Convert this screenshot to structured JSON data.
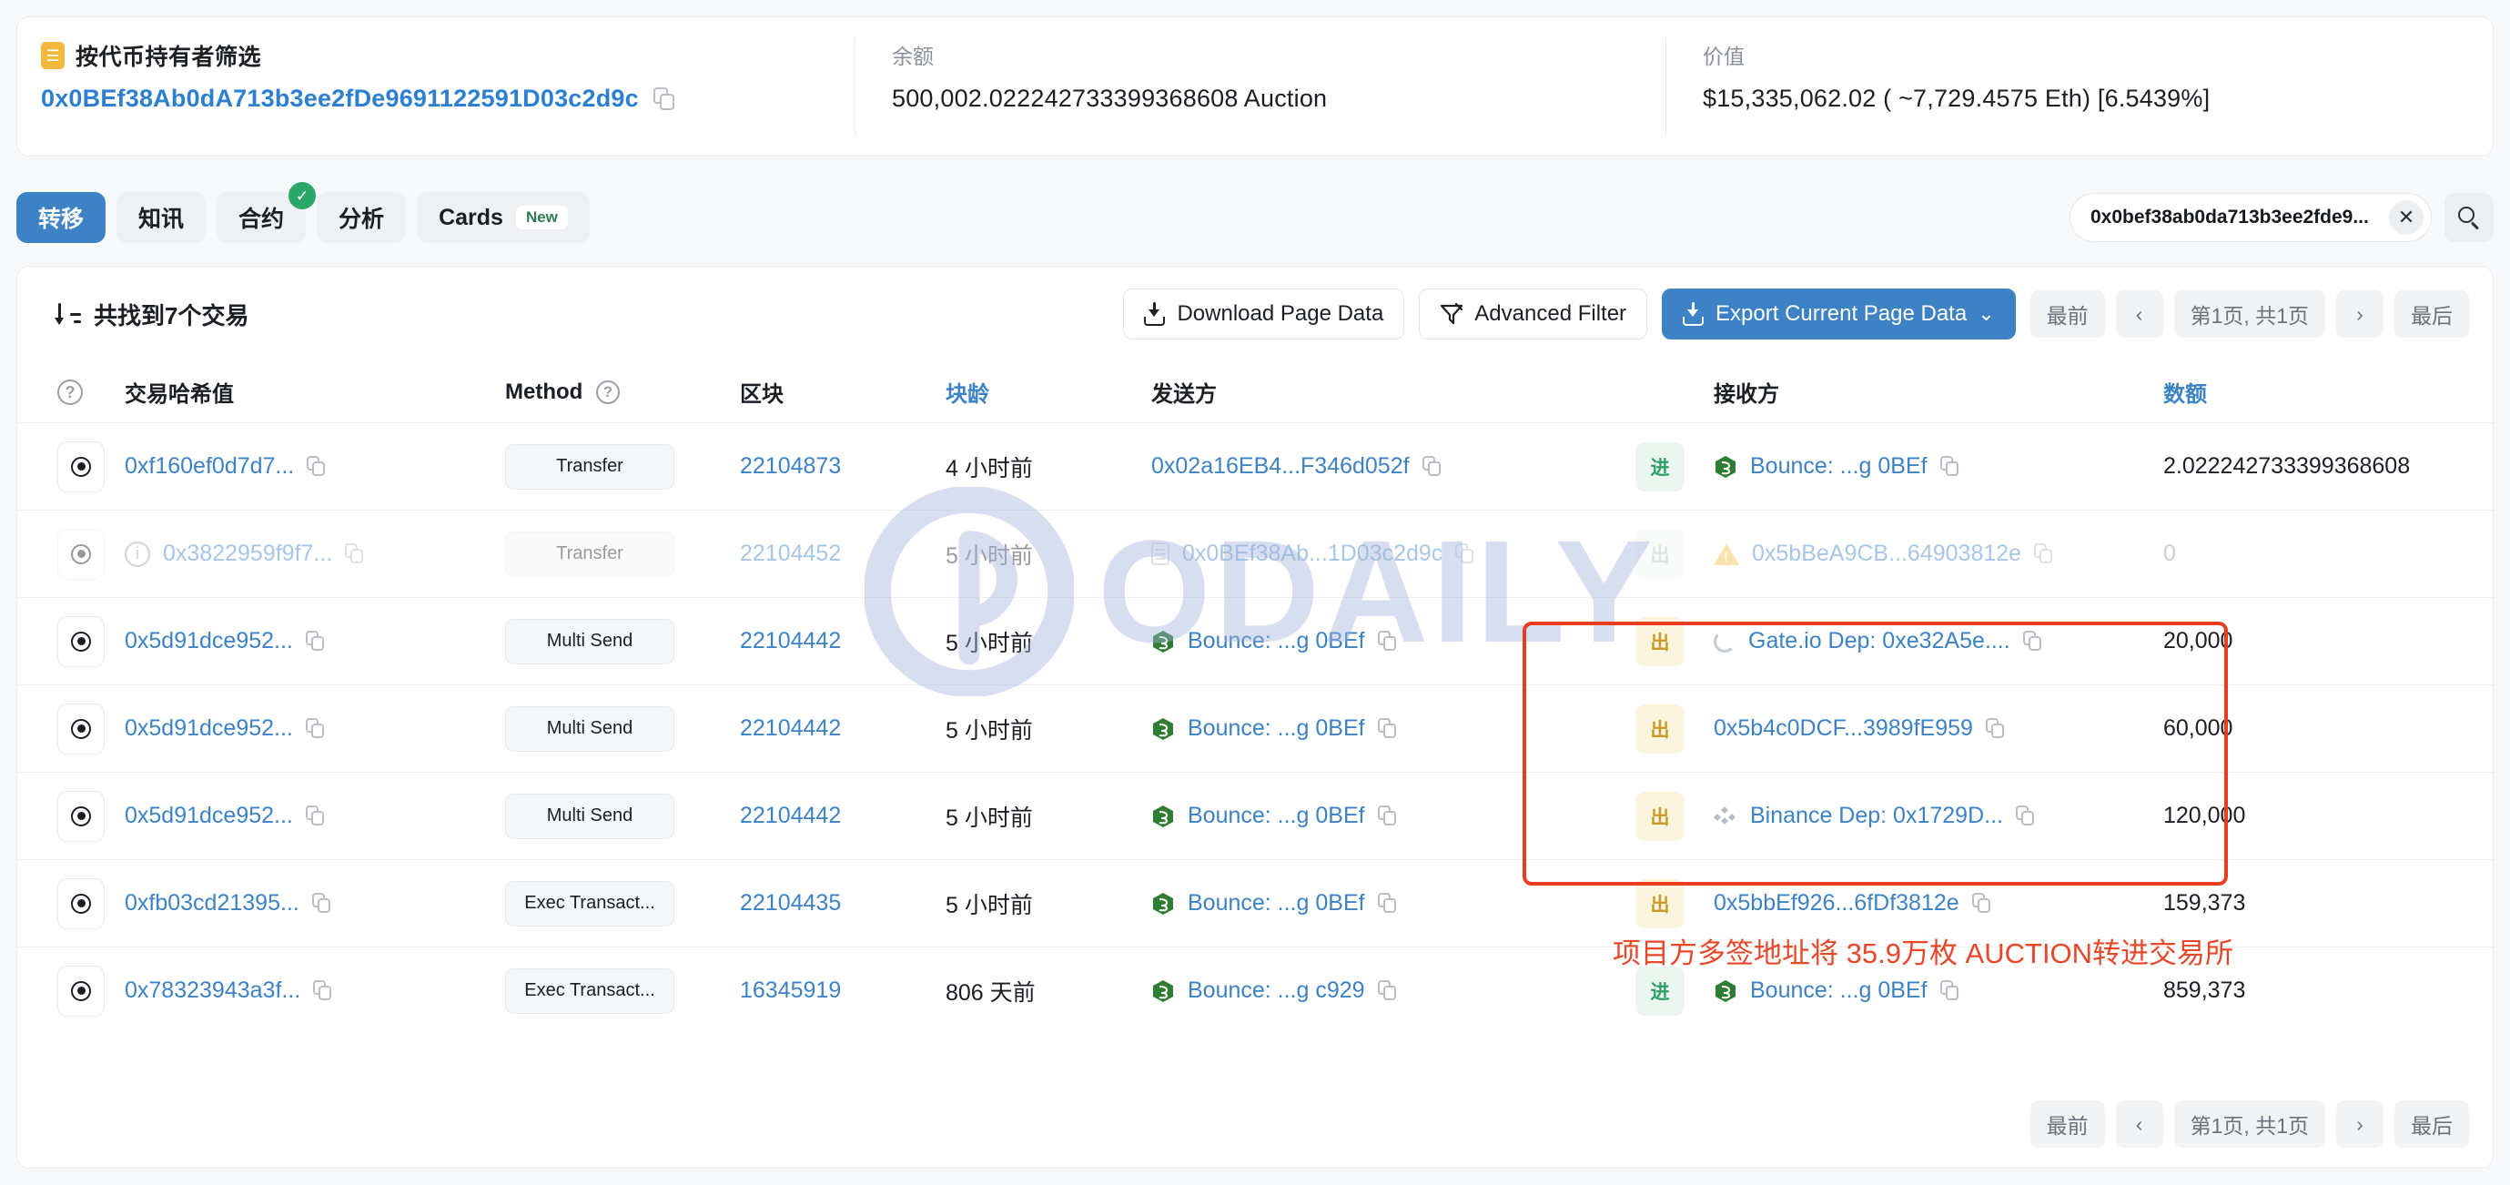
{
  "summary": {
    "filter_badge_icon": "token-filter-icon",
    "filter_title": "按代币持有者筛选",
    "address": "0x0BEf38Ab0dA713b3ee2fDe9691122591D03c2d9c",
    "balance_label": "余额",
    "balance_value": "500,002.022242733399368608 Auction",
    "value_label": "价值",
    "value_value": "$15,335,062.02 ( ~7,729.4575 Eth) [6.5439%]"
  },
  "tabs": [
    {
      "label": "转移",
      "active": true,
      "badge": "",
      "check": false
    },
    {
      "label": "知讯",
      "active": false,
      "badge": "",
      "check": false
    },
    {
      "label": "合约",
      "active": false,
      "badge": "",
      "check": true
    },
    {
      "label": "分析",
      "active": false,
      "badge": "",
      "check": false
    },
    {
      "label": "Cards",
      "active": false,
      "badge": "New",
      "check": false
    }
  ],
  "search": {
    "value": "0x0bef38ab0da713b3ee2fde9...",
    "clear_label": "✕",
    "icon": "search-icon"
  },
  "toolbar": {
    "found_text": "共找到7个交易",
    "download_page_data": "Download Page Data",
    "advanced_filter": "Advanced Filter",
    "export_current_page_data": "Export Current Page Data",
    "export_caret": "⌄"
  },
  "pagination": {
    "first": "最前",
    "prev": "‹",
    "status": "第1页, 共1页",
    "next": "›",
    "last": "最后"
  },
  "table": {
    "headers": {
      "eye": "",
      "hash": "交易哈希值",
      "method": "Method",
      "block": "区块",
      "age": "块龄",
      "from": "发送方",
      "dir": "",
      "to": "接收方",
      "amount": "数额"
    },
    "rows": [
      {
        "hash": "0xf160ef0d7d7...",
        "method": "Transfer",
        "block": "22104873",
        "age": "4 小时前",
        "from": "0x02a16EB4...F346d052f",
        "from_glyph": "none",
        "dir": "进",
        "dir_type": "in",
        "to": "Bounce: ...g 0BEf",
        "to_glyph": "bounce",
        "amount": "2.022242733399368608",
        "faded": false
      },
      {
        "hash": "0x3822959f9f7...",
        "method": "Transfer",
        "block": "22104452",
        "age": "5 小时前",
        "from": "0x0BEf38Ab...1D03c2d9c",
        "from_glyph": "doc",
        "dir": "出",
        "dir_type": "out-dim",
        "to": "0x5bBeA9CB...64903812e",
        "to_glyph": "warn",
        "amount": "0",
        "faded": true
      },
      {
        "hash": "0x5d91dce952...",
        "method": "Multi Send",
        "block": "22104442",
        "age": "5 小时前",
        "from": "Bounce: ...g 0BEf",
        "from_glyph": "bounce",
        "dir": "出",
        "dir_type": "out",
        "to": "Gate.io Dep: 0xe32A5e....",
        "to_glyph": "spin",
        "amount": "20,000",
        "faded": false
      },
      {
        "hash": "0x5d91dce952...",
        "method": "Multi Send",
        "block": "22104442",
        "age": "5 小时前",
        "from": "Bounce: ...g 0BEf",
        "from_glyph": "bounce",
        "dir": "出",
        "dir_type": "out",
        "to": "0x5b4c0DCF...3989fE959",
        "to_glyph": "none",
        "amount": "60,000",
        "faded": false
      },
      {
        "hash": "0x5d91dce952...",
        "method": "Multi Send",
        "block": "22104442",
        "age": "5 小时前",
        "from": "Bounce: ...g 0BEf",
        "from_glyph": "bounce",
        "dir": "出",
        "dir_type": "out",
        "to": "Binance Dep: 0x1729D...",
        "to_glyph": "bnb",
        "amount": "120,000",
        "faded": false
      },
      {
        "hash": "0xfb03cd21395...",
        "method": "Exec Transact...",
        "block": "22104435",
        "age": "5 小时前",
        "from": "Bounce: ...g 0BEf",
        "from_glyph": "bounce",
        "dir": "出",
        "dir_type": "out",
        "to": "0x5bbEf926...6fDf3812e",
        "to_glyph": "none",
        "amount": "159,373",
        "faded": false
      },
      {
        "hash": "0x78323943a3f...",
        "method": "Exec Transact...",
        "block": "16345919",
        "age": "806 天前",
        "from": "Bounce: ...g c929",
        "from_glyph": "bounce",
        "dir": "进",
        "dir_type": "in",
        "to": "Bounce: ...g 0BEf",
        "to_glyph": "bounce",
        "amount": "859,373",
        "faded": false
      }
    ]
  },
  "watermark": {
    "text": "ODAILY"
  },
  "annotation": {
    "text": "项目方多签地址将 35.9万枚 AUCTION转进交易所",
    "color": "#ea3c1e"
  }
}
